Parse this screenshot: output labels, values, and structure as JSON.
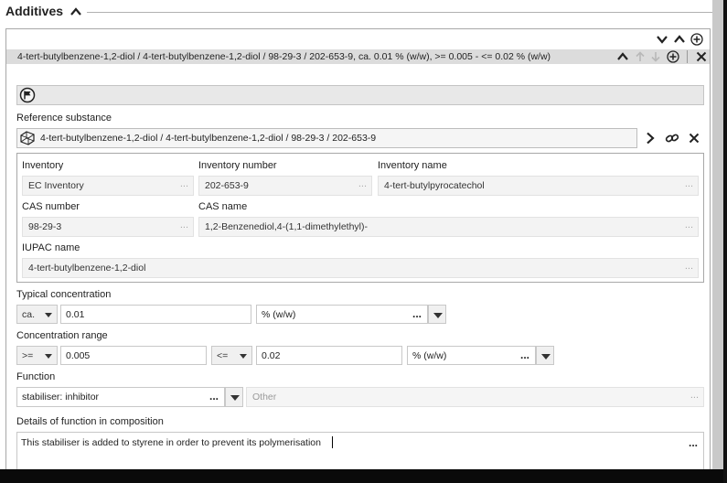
{
  "section": {
    "title": "Additives"
  },
  "block_row": "4-tert-butylbenzene-1,2-diol / 4-tert-butylbenzene-1,2-diol / 98-29-3 / 202-653-9, ca. 0.01 % (w/w), >= 0.005 - <= 0.02 % (w/w)",
  "reference_substance": {
    "label": "Reference substance",
    "value": "4-tert-butylbenzene-1,2-diol / 4-tert-butylbenzene-1,2-diol / 98-29-3 / 202-653-9"
  },
  "details": {
    "inventory_label": "Inventory",
    "inventory_value": "EC Inventory",
    "inventory_number_label": "Inventory number",
    "inventory_number_value": "202-653-9",
    "inventory_name_label": "Inventory name",
    "inventory_name_value": "4-tert-butylpyrocatechol",
    "cas_number_label": "CAS number",
    "cas_number_value": "98-29-3",
    "cas_name_label": "CAS name",
    "cas_name_value": "1,2-Benzenediol,4-(1,1-dimethylethyl)-",
    "iupac_name_label": "IUPAC name",
    "iupac_name_value": "4-tert-butylbenzene-1,2-diol"
  },
  "typical_concentration": {
    "label": "Typical concentration",
    "qualifier": "ca.",
    "value": "0.01",
    "unit": "% (w/w)"
  },
  "concentration_range": {
    "label": "Concentration range",
    "lower_qualifier": ">=",
    "lower_value": "0.005",
    "upper_qualifier": "<=",
    "upper_value": "0.02",
    "unit": "% (w/w)"
  },
  "function": {
    "label": "Function",
    "value": "stabiliser: inhibitor",
    "other_placeholder": "Other"
  },
  "details_of_function": {
    "label": "Details of function in composition",
    "value": "This stabiliser is added to styrene in order to prevent its polymerisation"
  },
  "ellipsis": "..."
}
